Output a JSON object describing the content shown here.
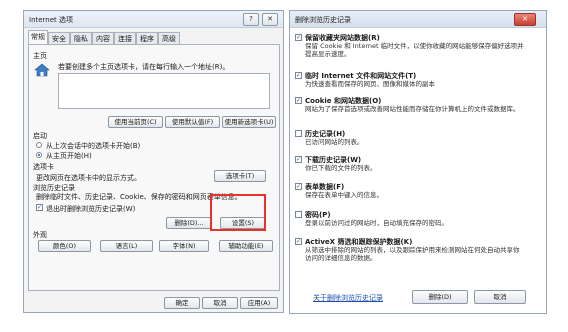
{
  "left_dialog": {
    "title": "Internet 选项",
    "help_glyph": "?",
    "close_glyph": "✕",
    "tabs": [
      "常规",
      "安全",
      "隐私",
      "内容",
      "连接",
      "程序",
      "高级"
    ],
    "home_group_label": "主页",
    "home_hint": "若要创建多个主页选项卡，请在每行输入一个地址(R)。",
    "home_buttons": [
      "使用当前页(C)",
      "使用默认值(F)",
      "使用新选项卡(U)"
    ],
    "startup_label": "启动",
    "startup_options": [
      "从上次会话中的选项卡开始(B)",
      "从主页开始(H)"
    ],
    "tabs_group_label": "选项卡",
    "tabs_hint": "更改网页在选项卡中的显示方式。",
    "tabs_button": "选项卡(T)",
    "history_label": "浏览历史记录",
    "history_hint": "删除临时文件、历史记录、Cookie、保存的密码和网页表单信息。",
    "delete_on_exit": "退出时删除浏览历史记录(W)",
    "delete_button": "删除(D)...",
    "settings_button": "设置(S)",
    "appearance_label": "外观",
    "appearance_buttons": [
      "颜色(O)",
      "语言(L)",
      "字体(N)",
      "辅助功能(E)"
    ],
    "footer_buttons": [
      "确定",
      "取消",
      "应用(A)"
    ]
  },
  "right_dialog": {
    "title": "删除浏览历史记录",
    "close_glyph": "✕",
    "items": [
      {
        "title": "保留收藏夹网站数据(R)",
        "desc": "保留 Cookie 和 Internet 临时文件，以使你收藏的网站能够保存偏好选项并提高显示速度。",
        "checked": true
      },
      {
        "title": "临时 Internet 文件和网站文件(T)",
        "desc": "为快速查看而保存的网页、图像和媒体的副本",
        "checked": true
      },
      {
        "title": "Cookie 和网站数据(O)",
        "desc": "网站为了保存首选项或改善网站性能而存储在你计算机上的文件或数据库。",
        "checked": true
      },
      {
        "title": "历史记录(H)",
        "desc": "已访问网站的列表。",
        "checked": false
      },
      {
        "title": "下载历史记录(W)",
        "desc": "你已下载的文件的列表。",
        "checked": true
      },
      {
        "title": "表单数据(F)",
        "desc": "保存在表单中键入的信息。",
        "checked": true
      },
      {
        "title": "密码(P)",
        "desc": "登录以前访问过的网站时，自动填充保存的密码。",
        "checked": false
      },
      {
        "title": "ActiveX 筛选和跟踪保护数据(K)",
        "desc": "从筛选中排除的网站的列表，以及跟踪保护用来检测网站在何处自动共享你访问的详细信息的数据。",
        "checked": true
      }
    ],
    "link": "关于删除浏览历史记录",
    "buttons": [
      "删除(D)",
      "取消"
    ]
  }
}
